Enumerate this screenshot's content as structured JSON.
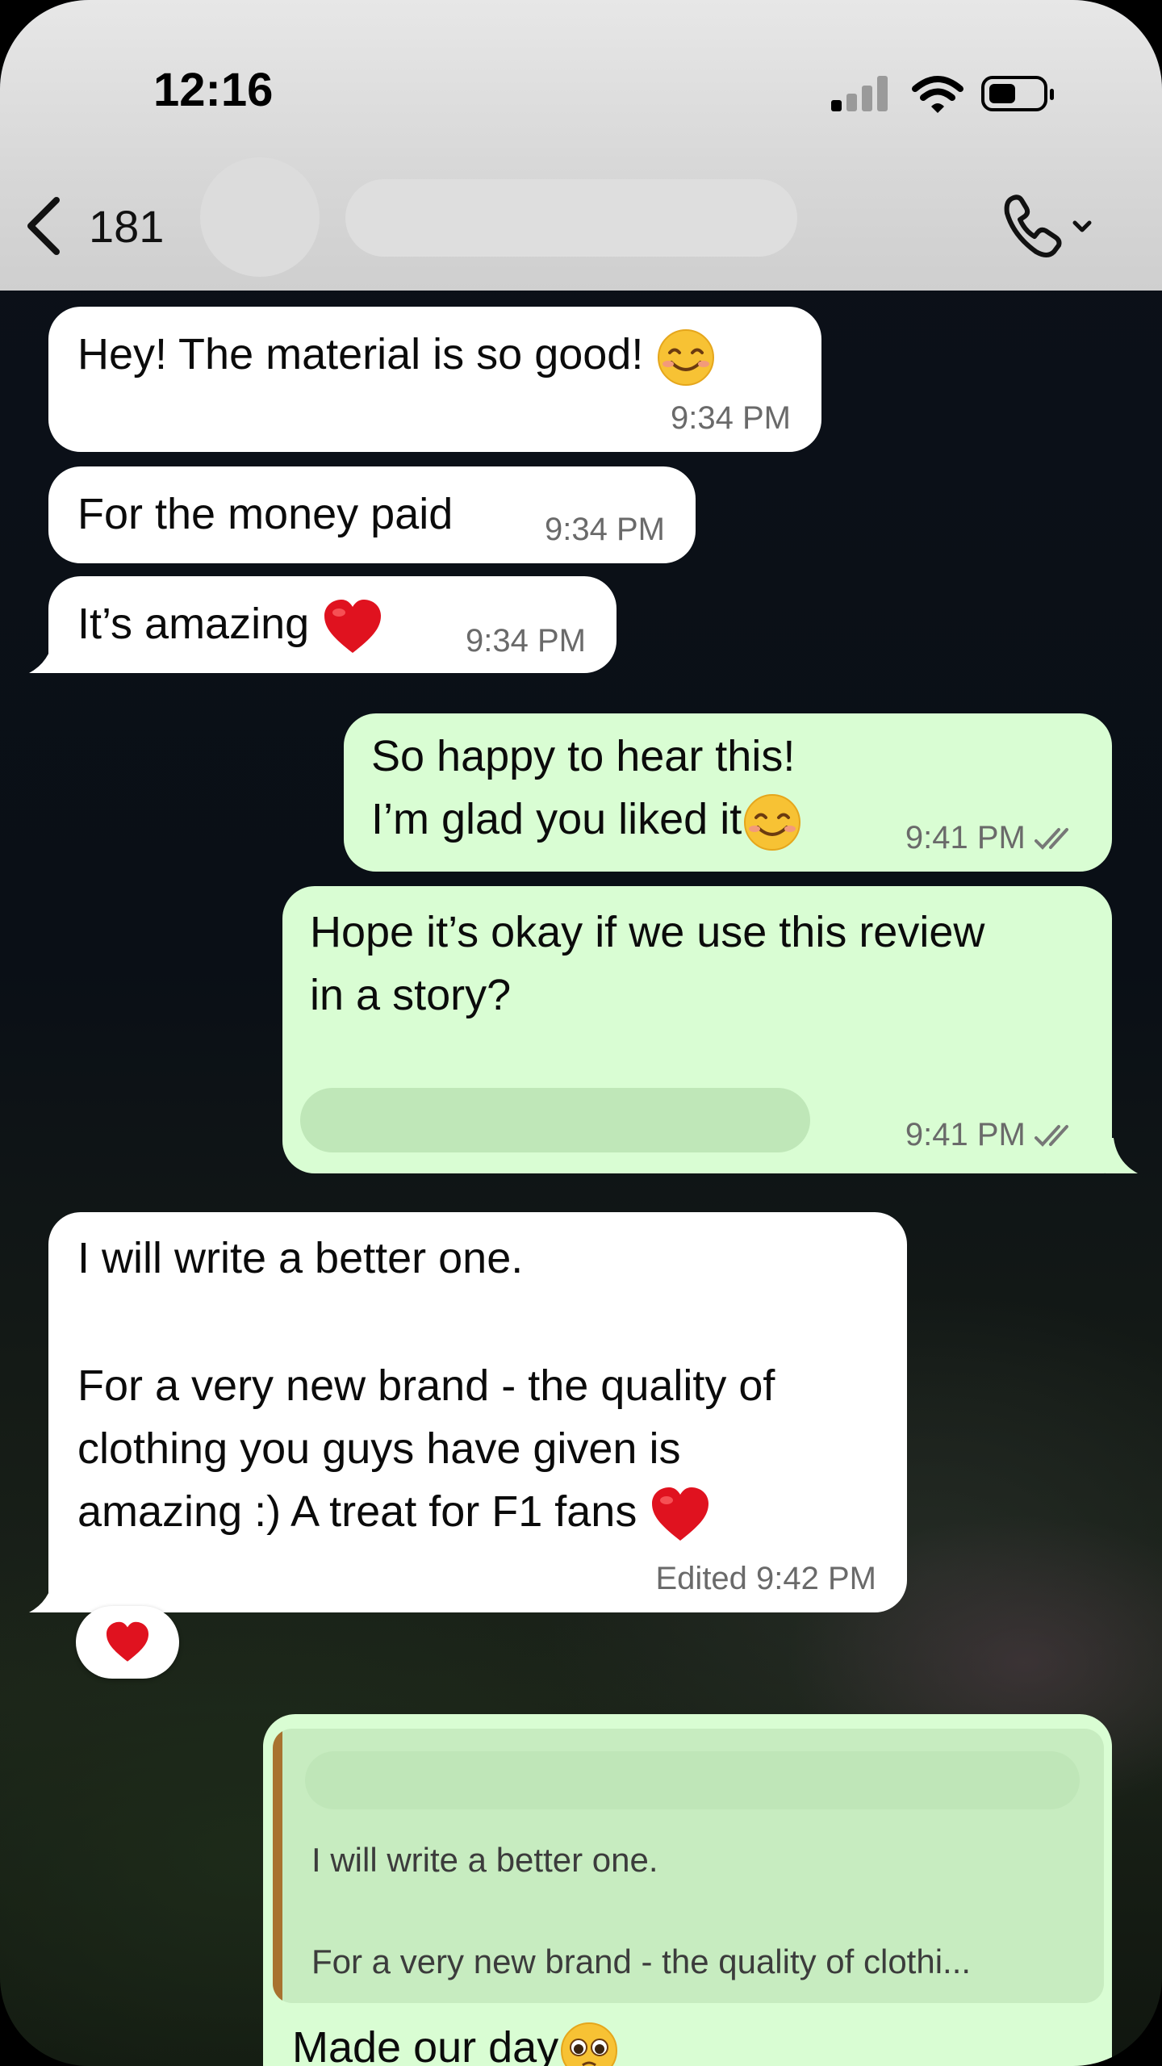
{
  "status_bar": {
    "time": "12:16"
  },
  "header": {
    "back_count": "181"
  },
  "messages": [
    {
      "text": "Hey! The material is so good! ",
      "time": "9:34 PM"
    },
    {
      "text": "For the money paid",
      "time": "9:34 PM"
    },
    {
      "text": "It’s amazing ",
      "time": "9:34 PM"
    },
    {
      "line1": "So happy to hear this!",
      "line2": "I’m glad you liked it",
      "time": "9:41 PM"
    },
    {
      "line1": "Hope it’s okay if we use this review",
      "line2": "in a story?",
      "time": "9:41 PM"
    },
    {
      "line1": "I will write a better one.",
      "line2": "For a very new brand - the quality of",
      "line3": "clothing you guys have given is",
      "line4": "amazing :) A treat for F1 fans ",
      "time": "Edited 9:42 PM"
    },
    {
      "quote_line1": "I will write a better one.",
      "quote_line2": "For a very new brand - the quality of clothi...",
      "text": "Made our day"
    }
  ],
  "colors": {
    "incoming": "#ffffff",
    "outgoing": "#d9fdd3",
    "header": "#d7d7d7",
    "quote_bar": "#a8722f"
  },
  "icons": [
    "signal-icon",
    "wifi-icon",
    "battery-icon",
    "back-chevron-icon",
    "phone-call-icon",
    "smile-emoji",
    "red-heart-emoji",
    "pleading-face-emoji",
    "double-check-icon"
  ]
}
